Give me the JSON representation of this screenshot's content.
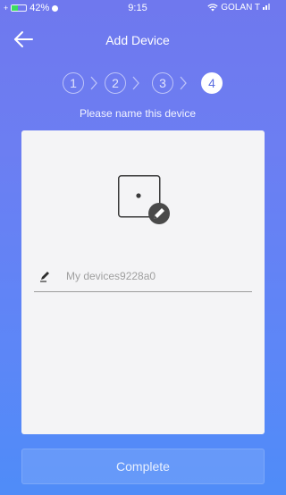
{
  "status_bar": {
    "battery": "42%",
    "time": "9:15",
    "carrier": "GOLAN T",
    "battery_level": 0.42
  },
  "header": {
    "title": "Add Device",
    "back_icon": "arrow-left-icon"
  },
  "stepper": {
    "steps": [
      "1",
      "2",
      "3",
      "4"
    ],
    "active_step": 4,
    "caption": "Please name this device"
  },
  "form": {
    "device_name_value": "My devices9228a0",
    "device_icon": "device-edit-icon",
    "field_icon": "pencil-icon"
  },
  "actions": {
    "complete_label": "Complete"
  },
  "colors": {
    "accent": "#5b6ee0",
    "card_background": "#f4f4f6",
    "battery_green": "#3ddc62"
  }
}
